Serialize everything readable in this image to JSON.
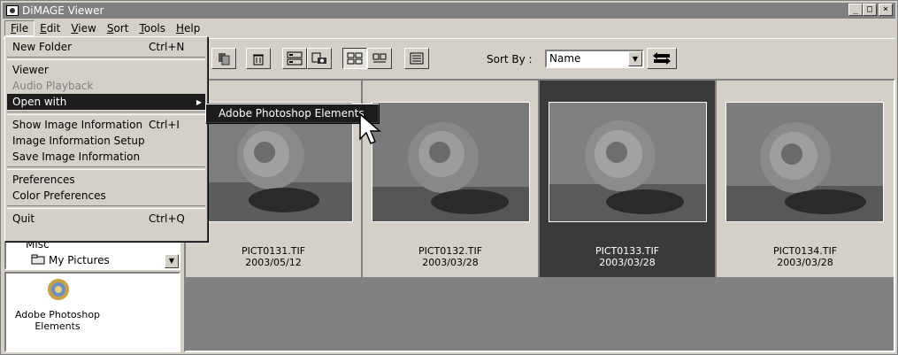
{
  "window": {
    "title": "DiMAGE Viewer",
    "minimize": "_",
    "maximize": "□",
    "close": "×"
  },
  "menubar": [
    "File",
    "Edit",
    "View",
    "Sort",
    "Tools",
    "Help"
  ],
  "file_menu": {
    "items": [
      {
        "label": "New Folder",
        "shortcut": "Ctrl+N"
      },
      {
        "label": "Viewer"
      },
      {
        "label": "Audio Playback",
        "disabled": true
      },
      {
        "label": "Open with",
        "submenu": true
      },
      {
        "label": "Show Image Information",
        "shortcut": "Ctrl+I"
      },
      {
        "label": "Image Information Setup"
      },
      {
        "label": "Save Image Information"
      },
      {
        "label": "Preferences"
      },
      {
        "label": "Color Preferences"
      },
      {
        "label": "Quit",
        "shortcut": "Ctrl+Q"
      }
    ],
    "submenu_item": "Adobe Photoshop Elements"
  },
  "toolbar": {
    "sort_by_label": "Sort By :",
    "sort_by_value": "Name"
  },
  "tree": {
    "items": [
      "Misc",
      "My Pictures"
    ]
  },
  "app_panel": {
    "label_line1": "Adobe Photoshop",
    "label_line2": "Elements"
  },
  "thumbnails": [
    {
      "name": "PICT0131.TIF",
      "date": "2003/05/12",
      "selected": false
    },
    {
      "name": "PICT0132.TIF",
      "date": "2003/03/28",
      "selected": false
    },
    {
      "name": "PICT0133.TIF",
      "date": "2003/03/28",
      "selected": true
    },
    {
      "name": "PICT0134.TIF",
      "date": "2003/03/28",
      "selected": false
    }
  ],
  "colors": {
    "title_bar": "#808080",
    "menu_highlight": "#1c1c1c",
    "selected_cell": "#3a3a3a",
    "gallery_bg": "#808080"
  }
}
